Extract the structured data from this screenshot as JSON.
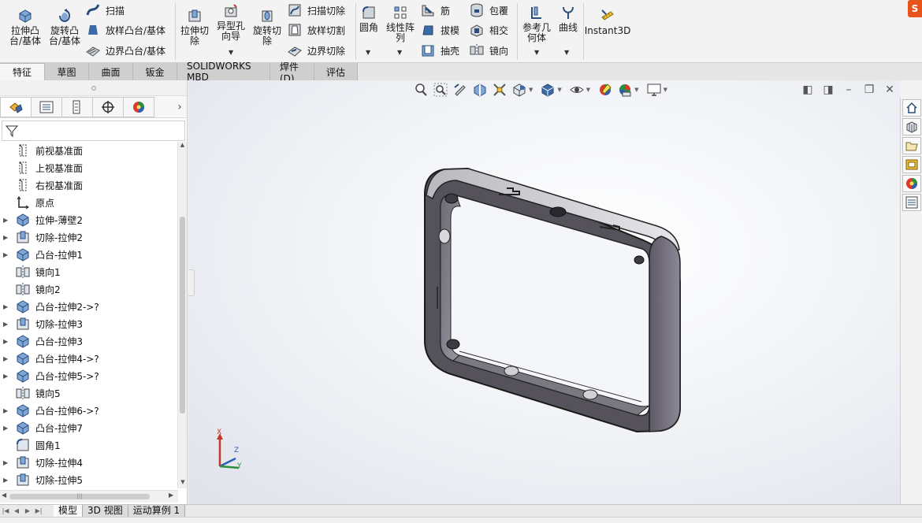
{
  "ribbon": {
    "boss_extrude": "拉伸凸\n台/基体",
    "revolve_boss": "旋转凸\n台/基体",
    "sweep": "扫描",
    "loft_boss": "放样凸台/基体",
    "boundary_boss": "边界凸台/基体",
    "extrude_cut": "拉伸切\n除",
    "hole_wizard": "异型孔\n向导",
    "revolve_cut": "旋转切\n除",
    "swept_cut": "扫描切除",
    "lofted_cut": "放样切割",
    "boundary_cut": "边界切除",
    "fillet": "圆角",
    "linear_pattern": "线性阵\n列",
    "rib": "筋",
    "draft": "拔模",
    "shell": "抽壳",
    "wrap": "包覆",
    "intersect": "相交",
    "mirror": "镜向",
    "ref_geometry": "参考几\n何体",
    "curves": "曲线",
    "instant3d": "Instant3D"
  },
  "tabs": [
    {
      "label": "特征",
      "active": true
    },
    {
      "label": "草图"
    },
    {
      "label": "曲面"
    },
    {
      "label": "钣金"
    },
    {
      "label": "SOLIDWORKS MBD"
    },
    {
      "label": "焊件(D)"
    },
    {
      "label": "评估"
    }
  ],
  "tree": [
    {
      "label": "前视基准面",
      "icon": "plane",
      "expandable": false
    },
    {
      "label": "上视基准面",
      "icon": "plane",
      "expandable": false
    },
    {
      "label": "右视基准面",
      "icon": "plane",
      "expandable": false
    },
    {
      "label": "原点",
      "icon": "origin",
      "expandable": false
    },
    {
      "label": "拉伸-薄壁2",
      "icon": "boss",
      "expandable": true
    },
    {
      "label": "切除-拉伸2",
      "icon": "cut",
      "expandable": true
    },
    {
      "label": "凸台-拉伸1",
      "icon": "boss",
      "expandable": true
    },
    {
      "label": "镜向1",
      "icon": "mirror",
      "expandable": false
    },
    {
      "label": "镜向2",
      "icon": "mirror",
      "expandable": false
    },
    {
      "label": "凸台-拉伸2->?",
      "icon": "boss",
      "expandable": true
    },
    {
      "label": "切除-拉伸3",
      "icon": "cut",
      "expandable": true
    },
    {
      "label": "凸台-拉伸3",
      "icon": "boss",
      "expandable": true
    },
    {
      "label": "凸台-拉伸4->?",
      "icon": "boss",
      "expandable": true
    },
    {
      "label": "凸台-拉伸5->?",
      "icon": "boss",
      "expandable": true
    },
    {
      "label": "镜向5",
      "icon": "mirror",
      "expandable": false
    },
    {
      "label": "凸台-拉伸6->?",
      "icon": "boss",
      "expandable": true
    },
    {
      "label": "凸台-拉伸7",
      "icon": "boss",
      "expandable": true
    },
    {
      "label": "圆角1",
      "icon": "fillet",
      "expandable": false
    },
    {
      "label": "切除-拉伸4",
      "icon": "cut",
      "expandable": true
    },
    {
      "label": "切除-拉伸5",
      "icon": "cut",
      "expandable": true
    }
  ],
  "triad": {
    "x": "X",
    "y": "Y",
    "z": "Z"
  },
  "bottom_tabs": [
    {
      "label": "模型",
      "active": true
    },
    {
      "label": "3D 视图"
    },
    {
      "label": "运动算例 1"
    }
  ],
  "colors": {
    "accent": "#1f5fa8",
    "part": "#8a8892",
    "logo": "#e8531c"
  }
}
